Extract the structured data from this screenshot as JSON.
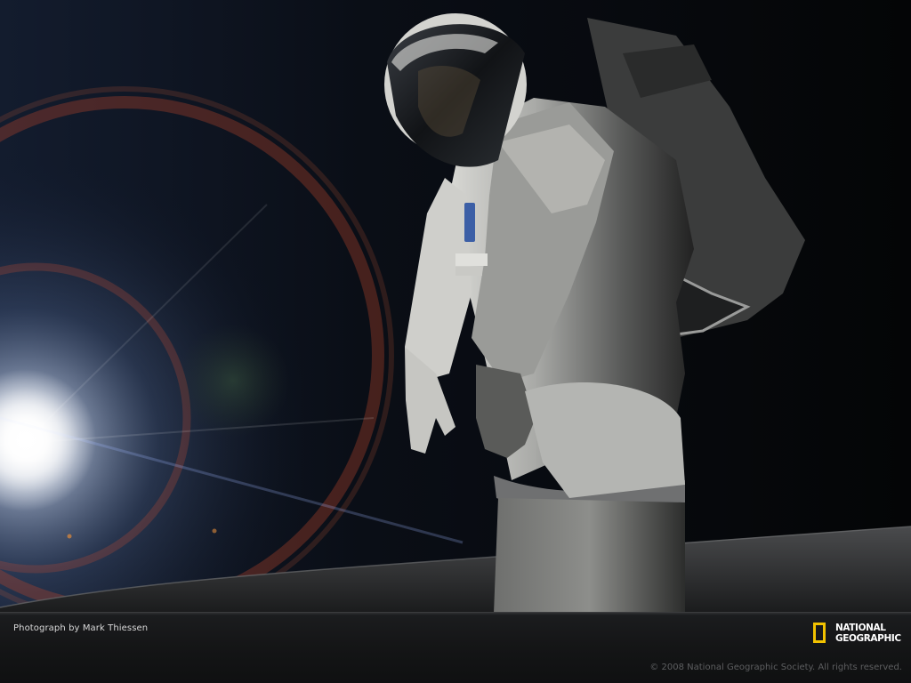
{
  "photo": {
    "subject": "astronaut-in-spacesuit",
    "background_color": "#05070a",
    "flare_color": "#ffffff",
    "ring_color": "#c84a2a",
    "suit_color": "#d9d9d6"
  },
  "caption_bar": {
    "credit": "Photograph by Mark Thiessen",
    "logo": {
      "line1": "NATIONAL",
      "line2": "GEOGRAPHIC",
      "border_color": "#f2c200"
    },
    "copyright": "© 2008 National Geographic Society. All rights reserved."
  }
}
